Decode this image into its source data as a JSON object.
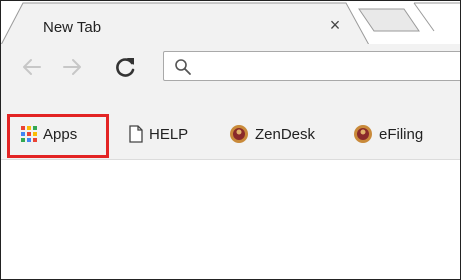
{
  "tab": {
    "title": "New Tab",
    "close_glyph": "×",
    "new_tab_label": ""
  },
  "toolbar": {
    "back_icon": "arrow-left-icon",
    "forward_icon": "arrow-right-icon",
    "reload_icon": "reload-icon",
    "omnibox": {
      "search_icon": "search-icon",
      "value": "",
      "placeholder": ""
    }
  },
  "bookmarks": {
    "items": [
      {
        "label": "Apps",
        "icon": "apps-grid-icon",
        "highlighted": true
      },
      {
        "label": "HELP",
        "icon": "page-icon"
      },
      {
        "label": "ZenDesk",
        "icon": "zendesk-favicon"
      },
      {
        "label": "eFiling",
        "icon": "efiling-favicon"
      }
    ]
  },
  "colors": {
    "highlight": "#e32424",
    "toolbar_bg": "#f2f2f2",
    "apps_grid": [
      "#ea4335",
      "#fbbc05",
      "#34a853",
      "#4285f4",
      "#ea4335",
      "#fbbc05",
      "#34a853",
      "#4285f4",
      "#ea4335"
    ]
  }
}
